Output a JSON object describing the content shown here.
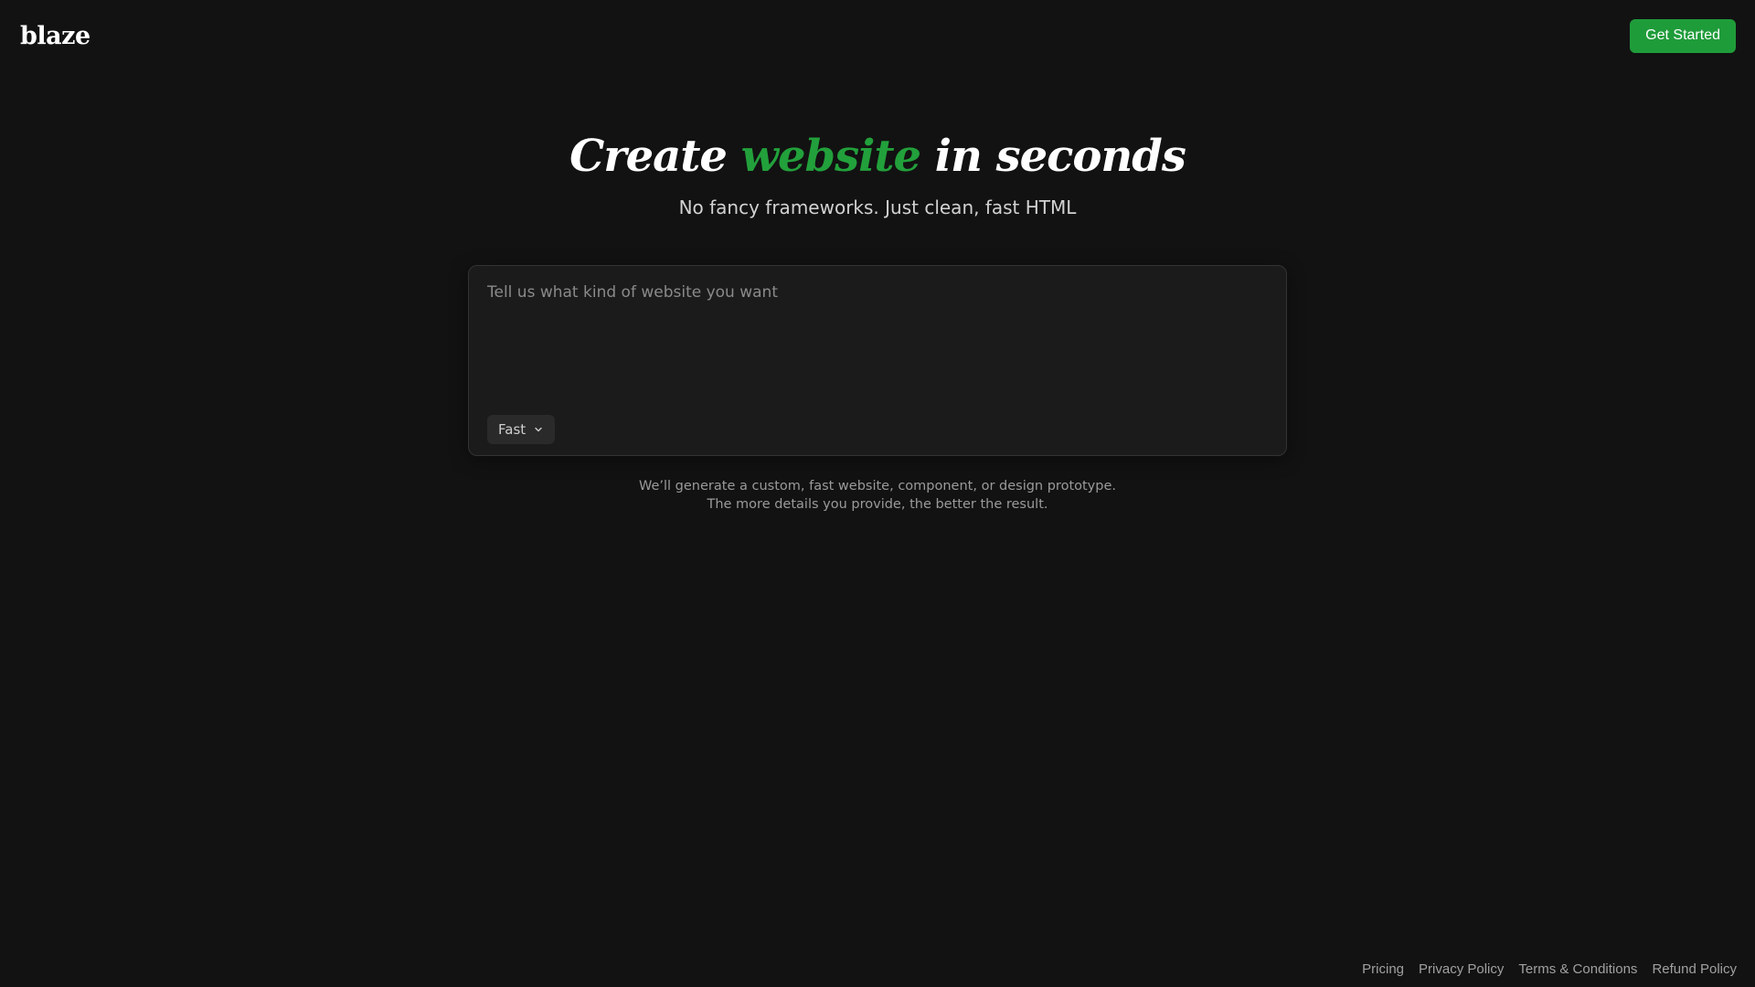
{
  "header": {
    "logo_text": "blaze",
    "cta_label": "Get Started"
  },
  "hero": {
    "headline_before": "Create ",
    "headline_accent": "website",
    "headline_after": " in seconds",
    "subheadline": "No fancy frameworks. Just clean, fast HTML"
  },
  "prompt": {
    "placeholder": "Tell us what kind of website you want",
    "value": "",
    "mode_selected": "Fast",
    "mode_icon": "chevron-down-icon"
  },
  "helper": {
    "line1": "We’ll generate a custom, fast website, component, or design prototype.",
    "line2": "The more details you provide, the better the result."
  },
  "footer": {
    "links": [
      "Pricing",
      "Privacy Policy",
      "Terms & Conditions",
      "Refund Policy"
    ]
  },
  "colors": {
    "background": "#121212",
    "accent": "#22a03b",
    "button": "#1f9c3a",
    "panel": "#1b1b1b"
  }
}
